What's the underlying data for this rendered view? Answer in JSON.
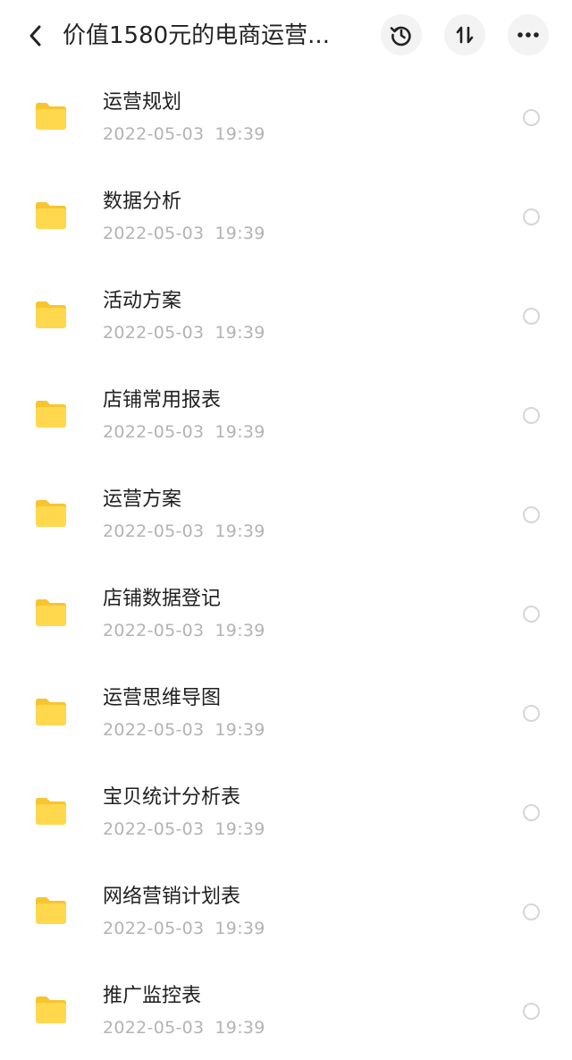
{
  "header": {
    "title": "价值1580元的电商运营...",
    "back_icon": "chevron-left-icon",
    "history_icon": "history-icon",
    "sort_icon": "sort-icon",
    "more_icon": "more-horizontal-icon"
  },
  "colors": {
    "folder": "#FFD84D",
    "folder_tab": "#F7C52E",
    "date_text": "#B3B3B3",
    "button_bg": "#F3F3F3"
  },
  "folders": [
    {
      "name": "运营规划",
      "date": "2022-05-03",
      "time": "19:39"
    },
    {
      "name": "数据分析",
      "date": "2022-05-03",
      "time": "19:39"
    },
    {
      "name": "活动方案",
      "date": "2022-05-03",
      "time": "19:39"
    },
    {
      "name": "店铺常用报表",
      "date": "2022-05-03",
      "time": "19:39"
    },
    {
      "name": "运营方案",
      "date": "2022-05-03",
      "time": "19:39"
    },
    {
      "name": "店铺数据登记",
      "date": "2022-05-03",
      "time": "19:39"
    },
    {
      "name": "运营思维导图",
      "date": "2022-05-03",
      "time": "19:39"
    },
    {
      "name": "宝贝统计分析表",
      "date": "2022-05-03",
      "time": "19:39"
    },
    {
      "name": "网络营销计划表",
      "date": "2022-05-03",
      "time": "19:39"
    },
    {
      "name": "推广监控表",
      "date": "2022-05-03",
      "time": "19:39"
    }
  ]
}
